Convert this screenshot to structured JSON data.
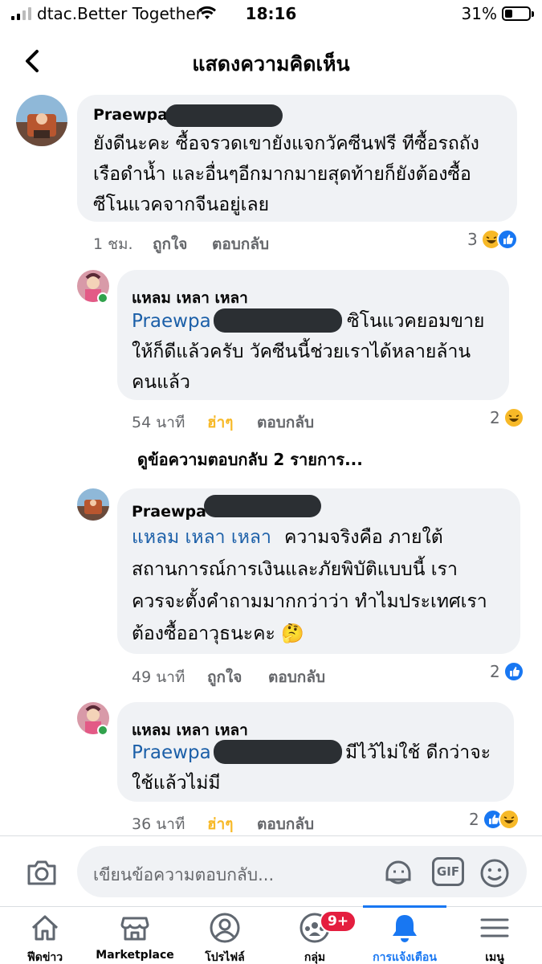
{
  "status_bar": {
    "carrier": "dtac.Better Together",
    "time": "18:16",
    "battery_percent": "31%",
    "battery_level": 0.31
  },
  "header": {
    "title": "แสดงความคิดเห็น",
    "back_icon": "chevron-left-icon"
  },
  "comments": [
    {
      "author": "Praewpai",
      "lines": [
        "ยังดีนะคะ ซื้อจรวดเขายังแจกวัคซีนฟรี ทีซื้อรถถัง",
        "เรือดำน้ำ และอื่นๆอีกมากมายสุดท้ายก็ยังต้องซื้อ",
        "ซีโนแวคจากจีนอยู่เลย"
      ],
      "time": "1 ชม.",
      "like_label": "ถูกใจ",
      "reply_label": "ตอบกลับ",
      "reaction_count": "3"
    },
    {
      "author": "แหลม เหลา เหลา",
      "mention": "Praewpa",
      "lines": [
        "ซิโนแวคยอมขาย",
        "ให้ก็ดีแล้วครับ วัคซีนนี้ช่วยเราได้หลายล้าน",
        "คนแล้ว"
      ],
      "time": "54 นาที",
      "like_label": "ฮ่าๆ",
      "reply_label": "ตอบกลับ",
      "reaction_count": "2"
    },
    {
      "author": "Praewpa",
      "mention": "แหลม เหลา เหลา",
      "lines": [
        "ความจริงคือ ภายใต้",
        "สถานการณ์การเงินและภัยพิบัติแบบนี้ เรา",
        "ควรจะตั้งคำถามมากกว่าว่า ทำไมประเทศเรา",
        "ต้องซื้ออาวุธนะคะ 🤔"
      ],
      "time": "49 นาที",
      "like_label": "ถูกใจ",
      "reply_label": "ตอบกลับ",
      "reaction_count": "2"
    },
    {
      "author": "แหลม เหลา เหลา",
      "mention": "Praewpa",
      "lines": [
        "มีไว้ไม่ใช้ ดีกว่าจะ",
        "ใช้แล้วไม่มี"
      ],
      "time": "36 นาที",
      "like_label": "ฮ่าๆ",
      "reply_label": "ตอบกลับ",
      "reaction_count": "2"
    }
  ],
  "more_replies": "ดูข้อความตอบกลับ 2 รายการ...",
  "composer": {
    "placeholder": "เขียนข้อความตอบกลับ...",
    "gif_label": "GIF"
  },
  "tabs": [
    {
      "label": "ฟีดข่าว",
      "icon": "home-icon"
    },
    {
      "label": "Marketplace",
      "icon": "marketplace-icon"
    },
    {
      "label": "โปรไฟล์",
      "icon": "profile-icon"
    },
    {
      "label": "กลุ่ม",
      "icon": "groups-icon",
      "badge": "9+"
    },
    {
      "label": "การแจ้งเตือน",
      "icon": "bell-icon",
      "active": true
    },
    {
      "label": "เมนู",
      "icon": "menu-icon"
    }
  ],
  "colors": {
    "accent": "#1877f2",
    "bubble": "#f0f2f5",
    "mention": "#1b5fa8",
    "haha": "#f7b928",
    "badge": "#e41e3f"
  }
}
